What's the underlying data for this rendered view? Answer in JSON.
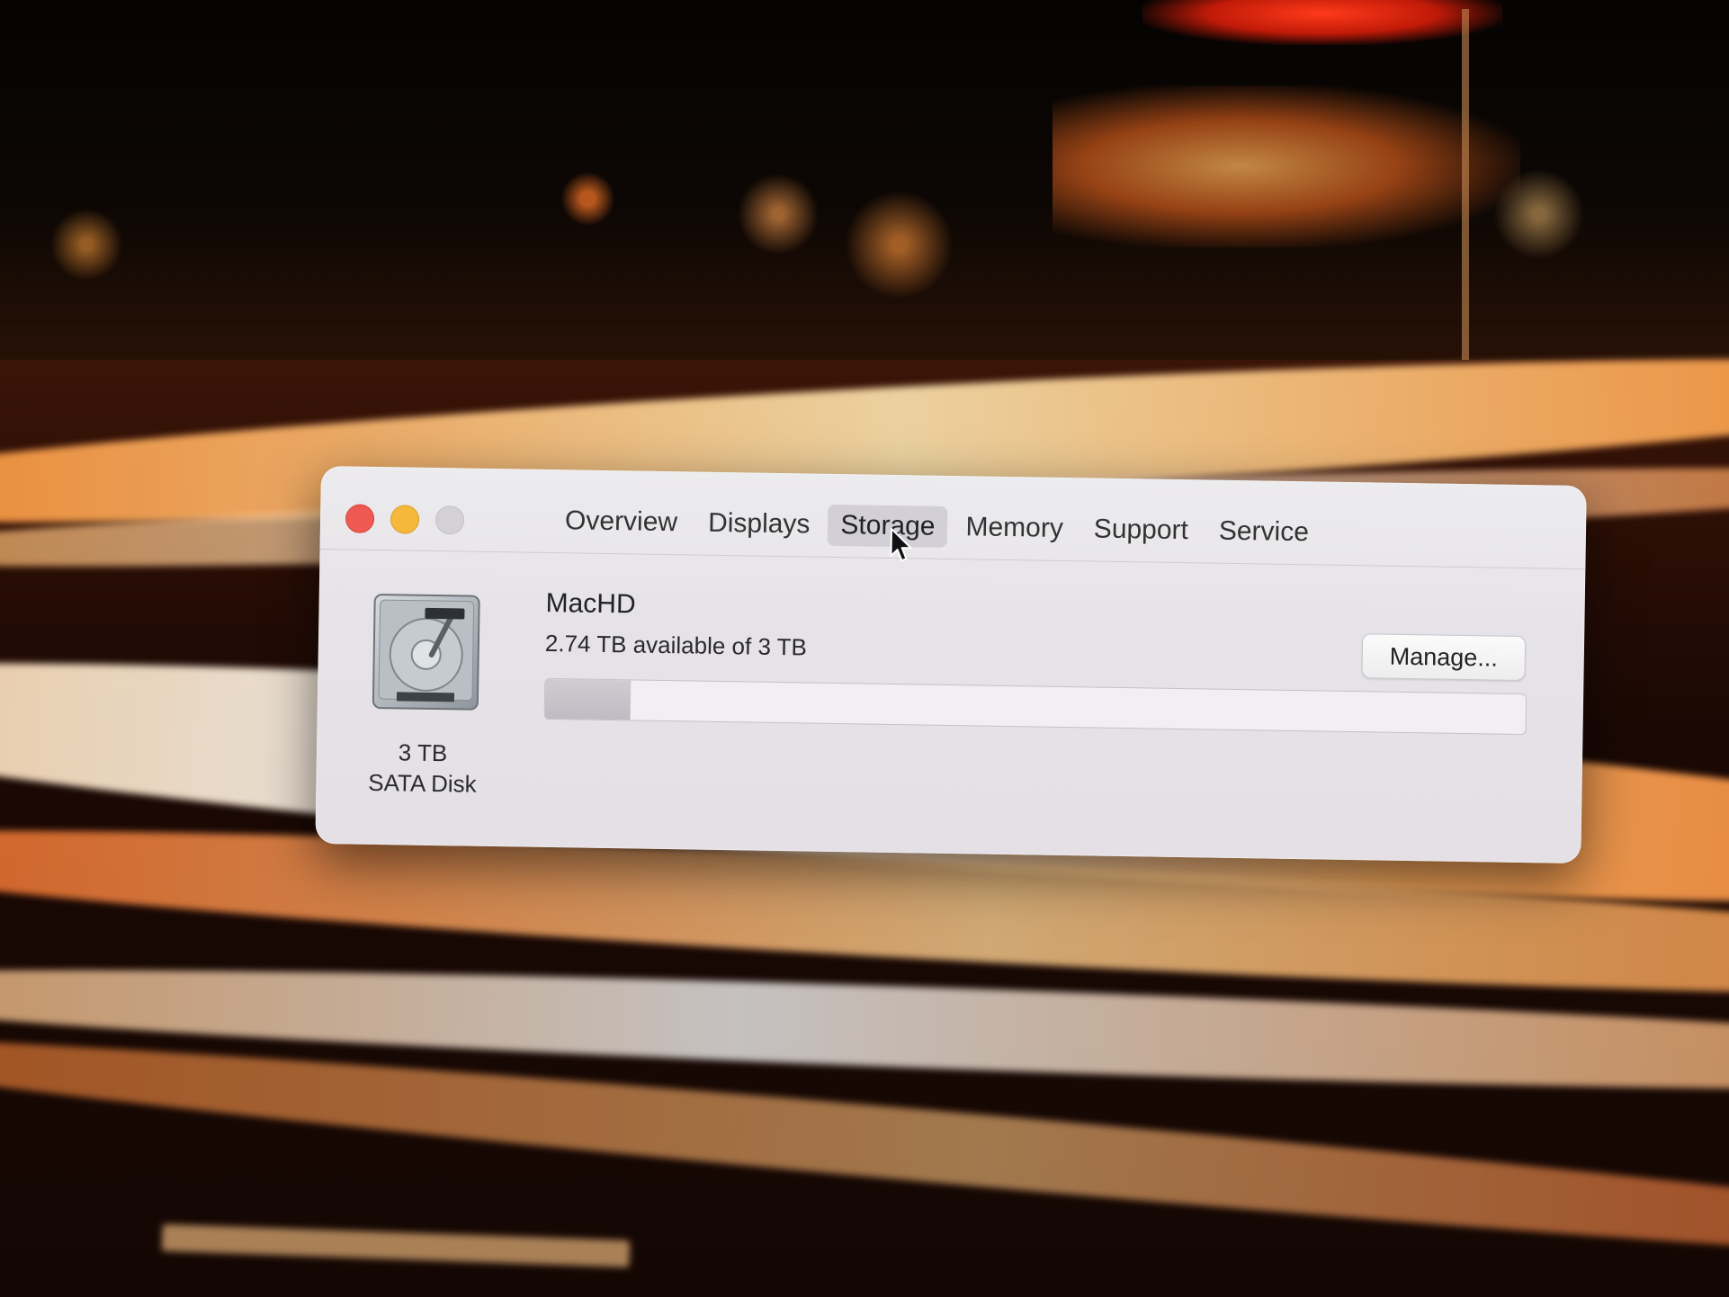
{
  "window": {
    "tabs": [
      {
        "label": "Overview",
        "selected": false
      },
      {
        "label": "Displays",
        "selected": false
      },
      {
        "label": "Storage",
        "selected": true
      },
      {
        "label": "Memory",
        "selected": false
      },
      {
        "label": "Support",
        "selected": false
      },
      {
        "label": "Service",
        "selected": false
      }
    ]
  },
  "storage": {
    "disk_capacity": "3 TB",
    "disk_type": "SATA Disk",
    "volume_name": "MacHD",
    "availability": "2.74 TB available of 3 TB",
    "used_fraction": 0.087,
    "manage_label": "Manage..."
  },
  "colors": {
    "close": "#ee5a52",
    "minimize": "#f4b83a",
    "zoom_disabled": "#d3d1d6"
  }
}
